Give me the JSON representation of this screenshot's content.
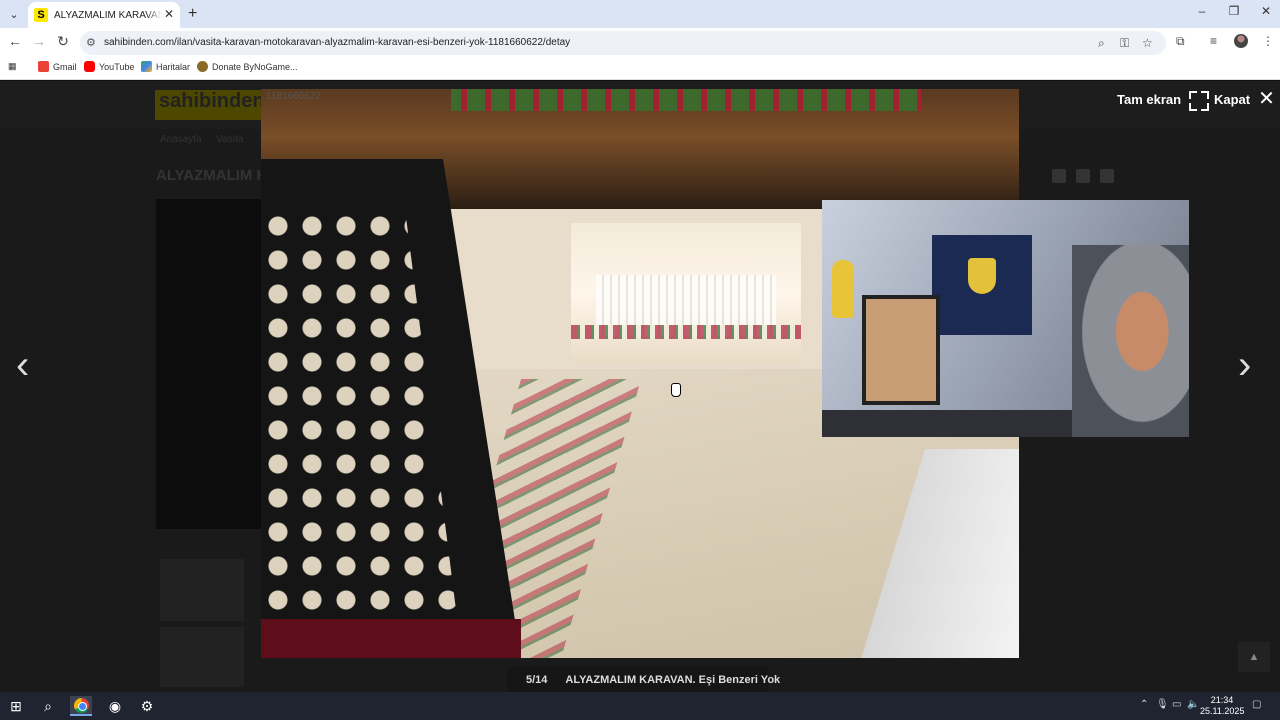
{
  "browser": {
    "tab_title": "ALYAZMALIM KARAVAN. Eşi Benzeri Yok",
    "favicon_letter": "S",
    "url": "sahibinden.com/ilan/vasita-karavan-motokaravan-alyazmalim-karavan-esi-benzeri-yok-1181660622/detay",
    "bookmarks": [
      {
        "label": "Gmail",
        "icon": "gmail-icon"
      },
      {
        "label": "YouTube",
        "icon": "youtube-icon"
      },
      {
        "label": "Haritalar",
        "icon": "maps-icon"
      },
      {
        "label": "Donate ByNoGame...",
        "icon": "donate-icon"
      }
    ]
  },
  "page": {
    "logo": "sahibinden.com",
    "title_dim": "ALYAZMALIM K",
    "breadcrumbs": [
      "Anasayfa",
      "Vasıta"
    ]
  },
  "lightbox": {
    "listing_no": "1181660622",
    "fullscreen_label": "Tam ekran",
    "close_label": "Kapat",
    "counter": "5/14",
    "caption": "ALYAZMALIM KARAVAN. Eşi Benzeri Yok"
  },
  "taskbar": {
    "time": "21:34",
    "date": "25.11.2025"
  },
  "colors": {
    "accent_yellow": "#ffe800",
    "tab_strip": "#dbe4f4",
    "overlay": "#111111"
  }
}
